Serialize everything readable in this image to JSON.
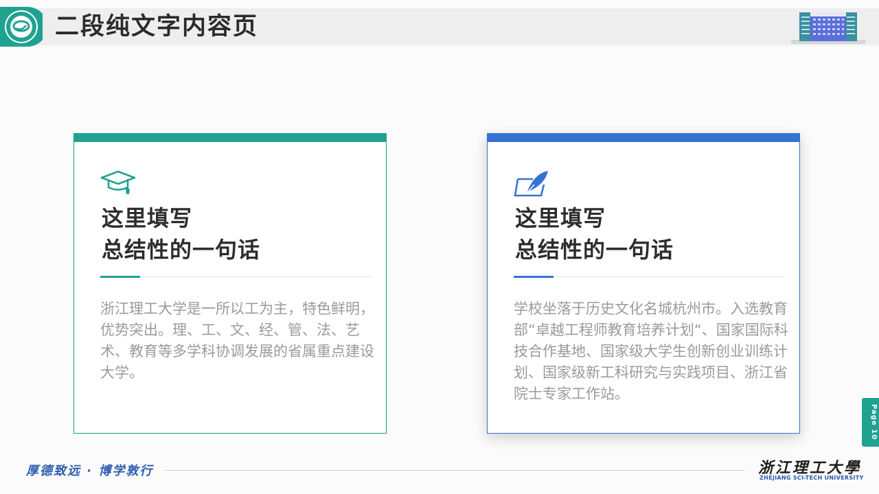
{
  "header": {
    "title": "二段纯文字内容页",
    "logo_icon": "university-seal-icon",
    "building_icon": "building-illustration-icon"
  },
  "cards": [
    {
      "icon": "graduation-cap-icon",
      "icon_color": "#1fa290",
      "accent_color": "#1fa290",
      "heading_line1": "这里填写",
      "heading_line2": "总结性的一句话",
      "body": "浙江理工大学是一所以工为主，特色鲜明，优势突出。理、工、文、经、管、法、艺术、教育等多学科协调发展的省属重点建设大学。"
    },
    {
      "icon": "feather-pen-icon",
      "icon_color": "#3473d4",
      "accent_color": "#3473d4",
      "heading_line1": "这里填写",
      "heading_line2": "总结性的一句话",
      "body": "学校坐落于历史文化名城杭州市。入选教育部“卓越工程师教育培养计划“、国家国际科技合作基地、国家级大学生创新创业训练计划、国家级新工科研究与实践项目、浙江省院士专家工作站。"
    }
  ],
  "footer": {
    "motto": "厚德致远 · 博学敦行",
    "university_cn": "浙江理工大學",
    "university_en": "ZHEJIANG SCI-TECH UNIVERSITY",
    "page_label": "Page 10"
  },
  "colors": {
    "teal": "#1fa290",
    "blue": "#3473d4"
  }
}
